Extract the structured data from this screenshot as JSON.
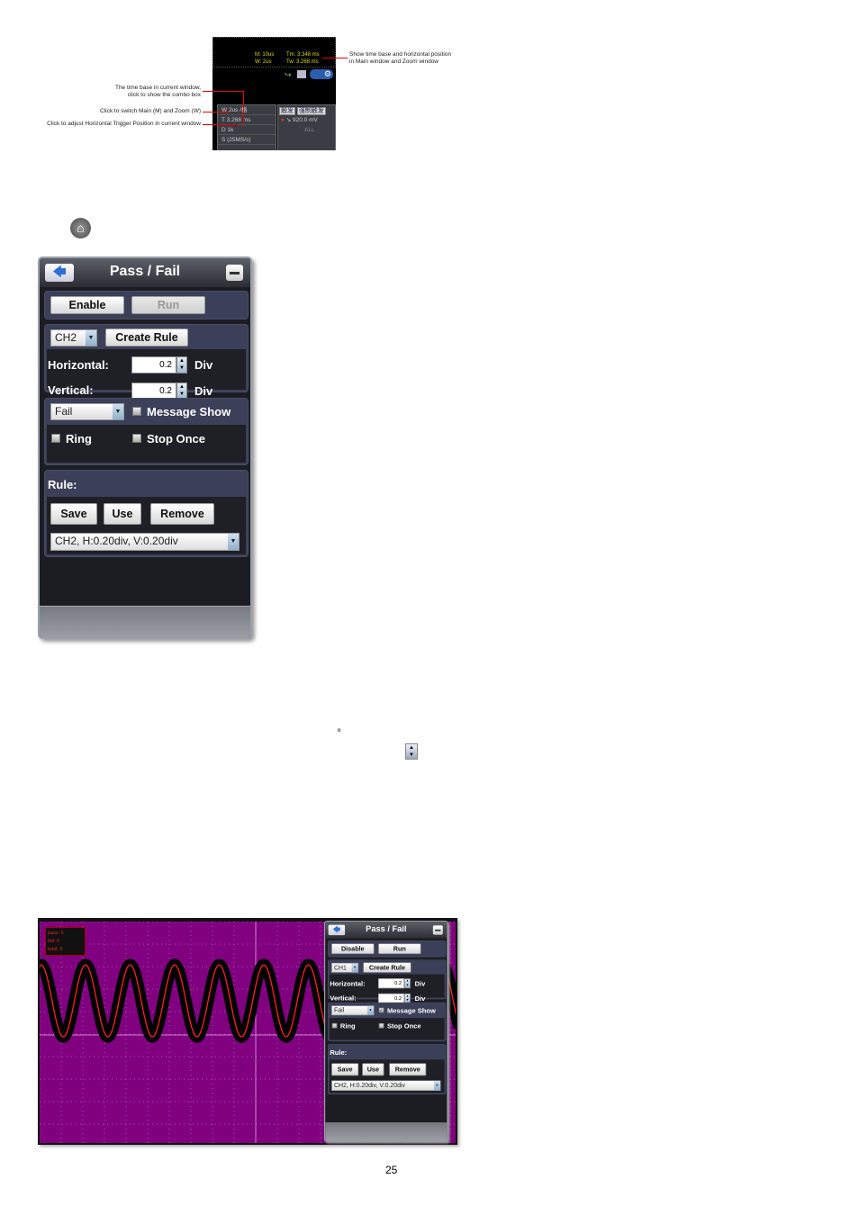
{
  "figure1": {
    "scope": {
      "main_timebase": "M: 10us",
      "zoom_timebase": "W: 2us",
      "main_pos": "Tm: 3.348 ms",
      "zoom_pos": "Tw: 3.268 ms",
      "rows": [
        "W    2us /格",
        "T    3.268 ms",
        "D    1k",
        "S    (25MS/s)"
      ],
      "trigger_tabs": [
        "触发",
        "强制触发"
      ],
      "trigger_level": "920.0 mV",
      "trigger_mode": "ALL"
    },
    "annotations": {
      "time_pos": [
        "Show time base and horizontal position",
        "in Main window and Zoom window"
      ],
      "timebase": [
        "The time base in current window,",
        "click to show the combo box"
      ],
      "switch": "Click to switch Main (M) and Zoom (W)",
      "trigger_pos": "Click to adjust Horizontal Trigger Position in current window"
    },
    "accent": "#e00000"
  },
  "home_icon": "home-icon",
  "degree_mark": "º",
  "panel1": {
    "title": "Pass / Fail",
    "enable": "Enable",
    "run": "Run",
    "run_disabled": true,
    "channel": "CH2",
    "create_rule": "Create Rule",
    "horizontal_label": "Horizontal:",
    "horizontal_value": "0.2",
    "vertical_label": "Vertical:",
    "vertical_value": "0.2",
    "unit": "Div",
    "output": "Fail",
    "message_show": "Message Show",
    "message_checked": false,
    "ring": "Ring",
    "stop_once": "Stop Once",
    "rule_label": "Rule:",
    "save": "Save",
    "use": "Use",
    "remove": "Remove",
    "rule_combo": "CH2, H:0.20div, V:0.20div"
  },
  "panel2": {
    "title": "Pass / Fail",
    "enable": "Disable",
    "run": "Run",
    "run_disabled": false,
    "channel": "CH1",
    "create_rule": "Create Rule",
    "horizontal_label": "Horizontal:",
    "horizontal_value": "0.2",
    "vertical_label": "Vertical:",
    "vertical_value": "0.2",
    "unit": "Div",
    "output": "Fail",
    "message_show": "Message Show",
    "message_checked": true,
    "ring": "Ring",
    "stop_once": "Stop Once",
    "rule_label": "Rule:",
    "save": "Save",
    "use": "Use",
    "remove": "Remove",
    "rule_combo": "CH2, H:0.20div, V:0.20div"
  },
  "waveform": {
    "counters": [
      "pass: 6",
      "fail: 0",
      "total: 6"
    ],
    "background": "#800080",
    "signal_color": "#ff2020",
    "mask_color": "#000000"
  },
  "page_number": "25"
}
